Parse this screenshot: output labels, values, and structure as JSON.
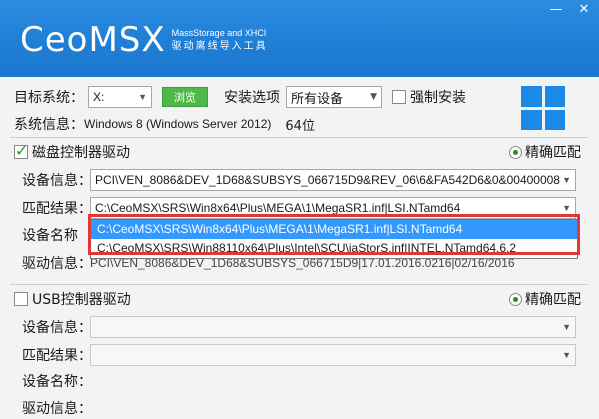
{
  "header": {
    "logo": "CeoMSX",
    "subtitle_en": "MassStorage and XHCI",
    "subtitle_cn": "驱动离线导入工具",
    "minimize": "—",
    "close": "✕"
  },
  "target": {
    "label": "目标系统：",
    "drive": "X:",
    "browse": "浏览",
    "install_label": "安装选项",
    "install_value": "所有设备",
    "force_label": "强制安装"
  },
  "sysinfo": {
    "label": "系统信息：",
    "os": "Windows 8 (Windows Server 2012)",
    "arch": "64位"
  },
  "disk": {
    "title": "磁盘控制器驱动",
    "exact": "精确匹配",
    "device_info_label": "设备信息：",
    "device_info_value": "PCI\\VEN_8086&DEV_1D68&SUBSYS_066715D9&REV_06\\6&FA542D6&0&00400008",
    "match_label": "匹配结果：",
    "match_value": "C:\\CeoMSX\\SRS\\Win8x64\\Plus\\MEGA\\1\\MegaSR1.inf|LSI.NTamd64",
    "device_name_label": "设备名称",
    "driver_info_label": "驱动信息：",
    "driver_info_value": "PCI\\VEN_8086&DEV_1D68&SUBSYS_066715D9|17.01.2016.0216|02/16/2016",
    "options": [
      "C:\\CeoMSX\\SRS\\Win8x64\\Plus\\MEGA\\1\\MegaSR1.inf|LSI.NTamd64",
      "C:\\CeoMSX\\SRS\\Win88110x64\\Plus\\Intel\\SCU\\iaStorS.inf|INTEL.NTamd64.6.2"
    ]
  },
  "usb": {
    "title": "USB控制器驱动",
    "exact": "精确匹配",
    "device_info_label": "设备信息：",
    "match_label": "匹配结果：",
    "device_name_label": "设备名称：",
    "driver_info_label": "驱动信息："
  }
}
